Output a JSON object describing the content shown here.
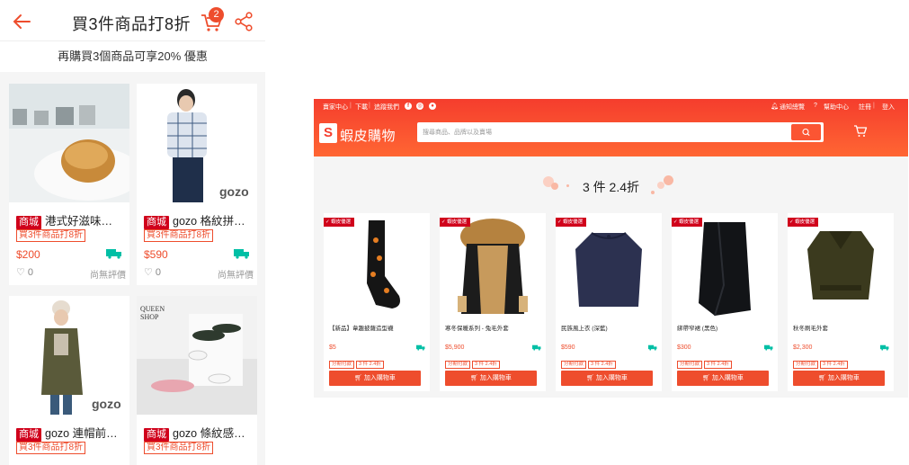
{
  "mobile": {
    "title": "買3件商品打8折",
    "cart_count": "2",
    "subtitle": "再購買3個商品可享20% 優惠",
    "mall_badge": "商城",
    "products": [
      {
        "name": "港式好滋味…",
        "tag": "買3件商品打8折",
        "price": "$200",
        "likes": "0",
        "reviews": "尚無評價"
      },
      {
        "name": "gozo 格紋拼…",
        "tag": "買3件商品打8折",
        "price": "$590",
        "likes": "0",
        "reviews": "尚無評價"
      },
      {
        "name": "gozo 連帽前…",
        "tag": "買3件商品打8折",
        "price": "",
        "likes": "",
        "reviews": ""
      },
      {
        "name": "gozo 條紋感…",
        "tag": "買3件商品打8折",
        "price": "",
        "likes": "",
        "reviews": ""
      }
    ],
    "image_marks": {
      "gozo": "gozo",
      "queen": "QUEEN SHOP"
    }
  },
  "web": {
    "topbar": {
      "seller_center": "賣家中心",
      "download": "下載",
      "follow": "追蹤我們",
      "notifications": "通知總覽",
      "help": "幫助中心",
      "register": "註冊",
      "login": "登入"
    },
    "brand": "蝦皮購物",
    "search_placeholder": "搜尋商品、品牌以及賣場",
    "heading": "3 件 2.4折",
    "ribbon": "蝦皮優選",
    "add_to_cart": "加入購物車",
    "installment_tag": "分期付款",
    "products": [
      {
        "name": "【新品】韋趣披薩造型襪",
        "price": "$5",
        "deal": "3 件 2.4折"
      },
      {
        "name": "寒冬保暖系列 - 兔毛外套",
        "price": "$5,900",
        "deal": "3 件 2.4折"
      },
      {
        "name": "民族風上衣 (深藍)",
        "price": "$590",
        "deal": "3 件 2.4折"
      },
      {
        "name": "綁帶窄裙 (黑色)",
        "price": "$300",
        "deal": "3 件 2.4折"
      },
      {
        "name": "秋冬刷毛外套",
        "price": "$2,300",
        "deal": "3 件 2.4折"
      }
    ]
  },
  "colors": {
    "brand": "#ee4d2d",
    "mall": "#d0011b",
    "shipping": "#00bfa5"
  }
}
